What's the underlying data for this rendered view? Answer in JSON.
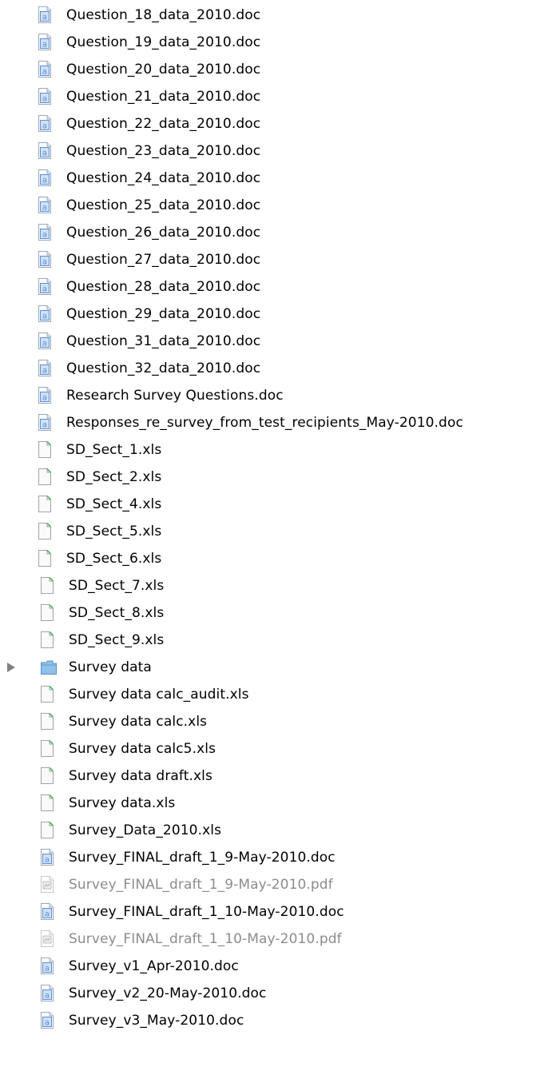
{
  "colors": {
    "text": "#000000",
    "dimmed_text": "#8c8c8c",
    "disclosure_triangle": "#808080",
    "doc_icon_accent": "#5b8fd6",
    "xls_icon_accent": "#2fb54a",
    "pdf_icon_accent": "#9a9a9a",
    "folder_icon": "#8fc1ea"
  },
  "files": [
    {
      "name": "Question_18_data_2010.doc",
      "icon": "word-document-icon",
      "dimmed": false,
      "folder": false,
      "shift": false
    },
    {
      "name": "Question_19_data_2010.doc",
      "icon": "word-document-icon",
      "dimmed": false,
      "folder": false,
      "shift": false
    },
    {
      "name": "Question_20_data_2010.doc",
      "icon": "word-document-icon",
      "dimmed": false,
      "folder": false,
      "shift": false
    },
    {
      "name": "Question_21_data_2010.doc",
      "icon": "word-document-icon",
      "dimmed": false,
      "folder": false,
      "shift": false
    },
    {
      "name": "Question_22_data_2010.doc",
      "icon": "word-document-icon",
      "dimmed": false,
      "folder": false,
      "shift": false
    },
    {
      "name": "Question_23_data_2010.doc",
      "icon": "word-document-icon",
      "dimmed": false,
      "folder": false,
      "shift": false
    },
    {
      "name": "Question_24_data_2010.doc",
      "icon": "word-document-icon",
      "dimmed": false,
      "folder": false,
      "shift": false
    },
    {
      "name": "Question_25_data_2010.doc",
      "icon": "word-document-icon",
      "dimmed": false,
      "folder": false,
      "shift": false
    },
    {
      "name": "Question_26_data_2010.doc",
      "icon": "word-document-icon",
      "dimmed": false,
      "folder": false,
      "shift": false
    },
    {
      "name": "Question_27_data_2010.doc",
      "icon": "word-document-icon",
      "dimmed": false,
      "folder": false,
      "shift": false
    },
    {
      "name": "Question_28_data_2010.doc",
      "icon": "word-document-icon",
      "dimmed": false,
      "folder": false,
      "shift": false
    },
    {
      "name": "Question_29_data_2010.doc",
      "icon": "word-document-icon",
      "dimmed": false,
      "folder": false,
      "shift": false
    },
    {
      "name": "Question_31_data_2010.doc",
      "icon": "word-document-icon",
      "dimmed": false,
      "folder": false,
      "shift": false
    },
    {
      "name": "Question_32_data_2010.doc",
      "icon": "word-document-icon",
      "dimmed": false,
      "folder": false,
      "shift": false
    },
    {
      "name": "Research Survey Questions.doc",
      "icon": "word-document-icon",
      "dimmed": false,
      "folder": false,
      "shift": false
    },
    {
      "name": "Responses_re_survey_from_test_recipients_May-2010.doc",
      "icon": "word-document-icon",
      "dimmed": false,
      "folder": false,
      "shift": false
    },
    {
      "name": "SD_Sect_1.xls",
      "icon": "spreadsheet-icon",
      "dimmed": false,
      "folder": false,
      "shift": false
    },
    {
      "name": "SD_Sect_2.xls",
      "icon": "spreadsheet-icon",
      "dimmed": false,
      "folder": false,
      "shift": false
    },
    {
      "name": "SD_Sect_4.xls",
      "icon": "spreadsheet-icon",
      "dimmed": false,
      "folder": false,
      "shift": false
    },
    {
      "name": "SD_Sect_5.xls",
      "icon": "spreadsheet-icon",
      "dimmed": false,
      "folder": false,
      "shift": false
    },
    {
      "name": "SD_Sect_6.xls",
      "icon": "spreadsheet-icon",
      "dimmed": false,
      "folder": false,
      "shift": false
    },
    {
      "name": "SD_Sect_7.xls",
      "icon": "spreadsheet-icon",
      "dimmed": false,
      "folder": false,
      "shift": true
    },
    {
      "name": "SD_Sect_8.xls",
      "icon": "spreadsheet-icon",
      "dimmed": false,
      "folder": false,
      "shift": true
    },
    {
      "name": "SD_Sect_9.xls",
      "icon": "spreadsheet-icon",
      "dimmed": false,
      "folder": false,
      "shift": true
    },
    {
      "name": "Survey data",
      "icon": "folder-icon",
      "dimmed": false,
      "folder": true,
      "shift": true
    },
    {
      "name": "Survey data calc_audit.xls",
      "icon": "spreadsheet-icon",
      "dimmed": false,
      "folder": false,
      "shift": true
    },
    {
      "name": "Survey data calc.xls",
      "icon": "spreadsheet-icon",
      "dimmed": false,
      "folder": false,
      "shift": true
    },
    {
      "name": "Survey data calc5.xls",
      "icon": "spreadsheet-icon",
      "dimmed": false,
      "folder": false,
      "shift": true
    },
    {
      "name": "Survey data draft.xls",
      "icon": "spreadsheet-icon",
      "dimmed": false,
      "folder": false,
      "shift": true
    },
    {
      "name": "Survey data.xls",
      "icon": "spreadsheet-icon",
      "dimmed": false,
      "folder": false,
      "shift": true
    },
    {
      "name": "Survey_Data_2010.xls",
      "icon": "spreadsheet-icon",
      "dimmed": false,
      "folder": false,
      "shift": true
    },
    {
      "name": "Survey_FINAL_draft_1_9-May-2010.doc",
      "icon": "word-document-icon",
      "dimmed": false,
      "folder": false,
      "shift": true
    },
    {
      "name": "Survey_FINAL_draft_1_9-May-2010.pdf",
      "icon": "pdf-document-icon",
      "dimmed": true,
      "folder": false,
      "shift": true
    },
    {
      "name": "Survey_FINAL_draft_1_10-May-2010.doc",
      "icon": "word-document-icon",
      "dimmed": false,
      "folder": false,
      "shift": true
    },
    {
      "name": "Survey_FINAL_draft_1_10-May-2010.pdf",
      "icon": "pdf-document-icon",
      "dimmed": true,
      "folder": false,
      "shift": true
    },
    {
      "name": "Survey_v1_Apr-2010.doc",
      "icon": "word-document-icon",
      "dimmed": false,
      "folder": false,
      "shift": true
    },
    {
      "name": "Survey_v2_20-May-2010.doc",
      "icon": "word-document-icon",
      "dimmed": false,
      "folder": false,
      "shift": true
    },
    {
      "name": "Survey_v3_May-2010.doc",
      "icon": "word-document-icon",
      "dimmed": false,
      "folder": false,
      "shift": true
    }
  ]
}
